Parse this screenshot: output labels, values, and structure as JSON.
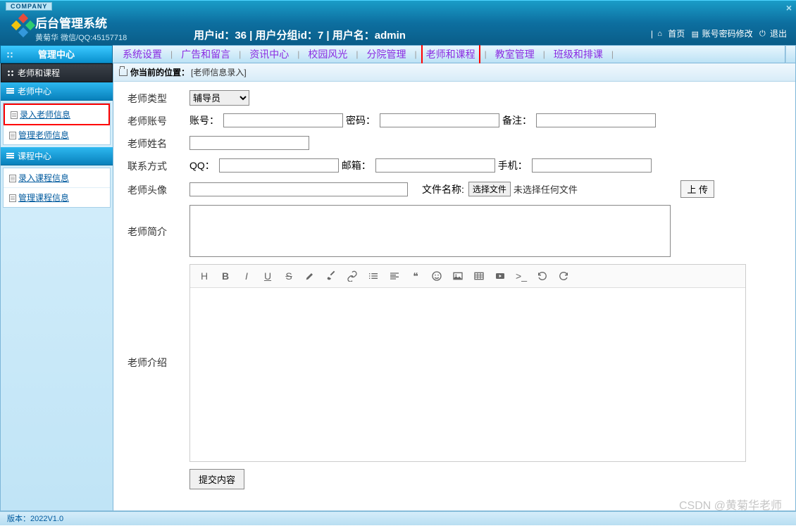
{
  "banner": {
    "company_label": "COMPANY",
    "title": "后台管理系统",
    "subtitle": "黄菊华  微信/QQ:45157718",
    "user_info": "用户id：36 | 用户分组id：7 | 用户名：admin",
    "links": {
      "home": "首页",
      "pwchange": "账号密码修改",
      "logout": "退出"
    }
  },
  "hnav": {
    "mgmt_center": "管理中心",
    "items": [
      "系统设置",
      "广告和留言",
      "资讯中心",
      "校园风光",
      "分院管理",
      "老师和课程",
      "教室管理",
      "班级和排课"
    ],
    "highlighted_index": 5
  },
  "sidebar": {
    "top_title": "老师和课程",
    "groups": [
      {
        "title": "老师中心",
        "items": [
          "录入老师信息",
          "管理老师信息"
        ],
        "highlighted_index": 0
      },
      {
        "title": "课程中心",
        "items": [
          "录入课程信息",
          "管理课程信息"
        ],
        "highlighted_index": -1
      }
    ]
  },
  "breadcrumb": {
    "label": "你当前的位置：",
    "path": "[老师信息录入]"
  },
  "form": {
    "teacher_type_label": "老师类型",
    "teacher_type_value": "辅导员",
    "account_label": "老师账号",
    "account_field": "账号：",
    "password_field": "密码：",
    "remark_field": "备注：",
    "name_label": "老师姓名",
    "contact_label": "联系方式",
    "qq_field": "QQ：",
    "email_field": "邮箱：",
    "phone_field": "手机：",
    "avatar_label": "老师头像",
    "filename_label": "文件名称:",
    "choose_file": "选择文件",
    "no_file": "未选择任何文件",
    "upload": "上 传",
    "brief_label": "老师简介",
    "intro_label": "老师介绍",
    "submit": "提交内容"
  },
  "editor_icons": [
    "heading",
    "bold",
    "italic",
    "underline",
    "strike",
    "highlighter",
    "brush",
    "link",
    "list",
    "align",
    "quote",
    "emoji",
    "image",
    "table",
    "video",
    "code",
    "undo",
    "redo"
  ],
  "footer": "版本：2022V1.0",
  "watermark": "CSDN @黄菊华老师"
}
